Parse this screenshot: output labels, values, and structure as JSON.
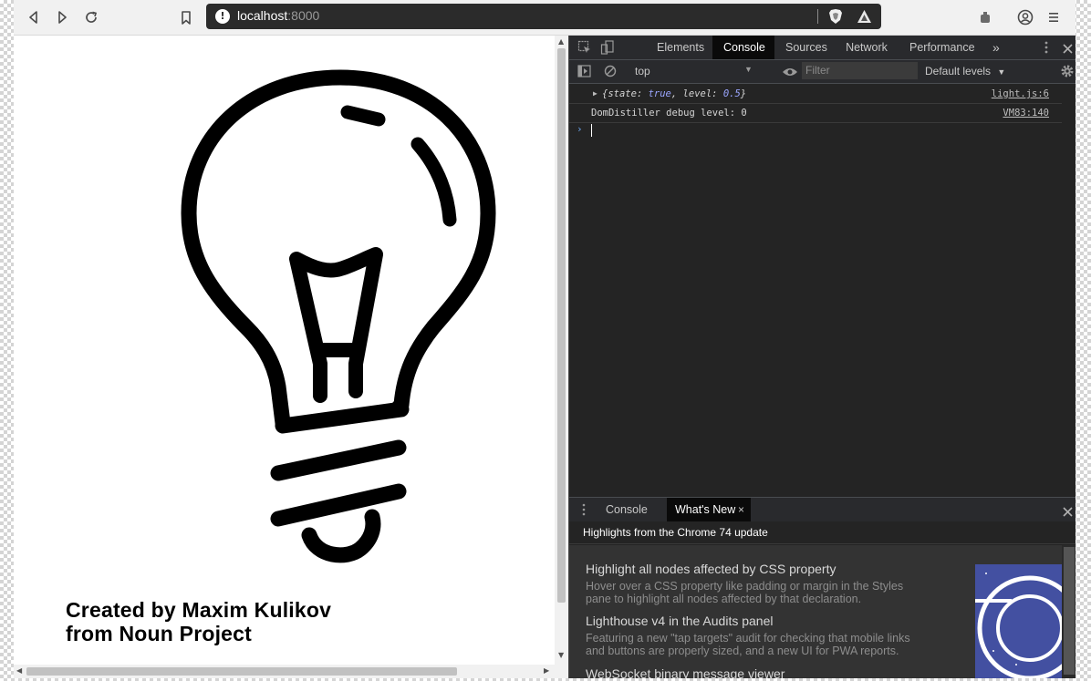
{
  "browser": {
    "url_host": "localhost",
    "url_port": ":8000"
  },
  "page": {
    "credit_line1": "Created by Maxim Kulikov",
    "credit_line2": "from Noun Project"
  },
  "devtools": {
    "tabs": [
      "Elements",
      "Console",
      "Sources",
      "Network",
      "Performance",
      "»"
    ],
    "active_tab": "Console",
    "context": "top",
    "filter_placeholder": "Filter",
    "levels_label": "Default levels",
    "messages": [
      {
        "prefix": "{",
        "k1": "state",
        "v1": "true",
        "k2": "level",
        "v2": "0.5",
        "suffix": "}",
        "source": "light.js:6"
      },
      {
        "text": "DomDistiller debug level: 0",
        "source": "VM83:140"
      }
    ],
    "drawer": {
      "tabs": [
        "Console",
        "What's New"
      ],
      "active_tab": "What's New",
      "header": "Highlights from the Chrome 74 update",
      "items": [
        {
          "title": "Highlight all nodes affected by CSS property",
          "desc_line1": "Hover over a CSS property like padding or margin in the Styles",
          "desc_line2": "pane to highlight all nodes affected by that declaration."
        },
        {
          "title": "Lighthouse v4 in the Audits panel",
          "desc_line1": "Featuring a new \"tap targets\" audit for checking that mobile links",
          "desc_line2": "and buttons are properly sized, and a new UI for PWA reports."
        },
        {
          "title": "WebSocket binary message viewer"
        }
      ]
    }
  },
  "colors": {
    "devtools_bg": "#242424",
    "whatsnew_thumb": "#4350a1",
    "link_value": "#9ba6ff"
  },
  "icons": {
    "toolbar": [
      "back-icon",
      "forward-icon",
      "reload-icon",
      "bookmark-icon",
      "info-icon",
      "brave-shield-icon",
      "brave-rewards-icon",
      "extension-icon",
      "profile-icon",
      "menu-icon"
    ],
    "devtools": [
      "inspect-element-icon",
      "device-toggle-icon",
      "more-vert-icon",
      "close-icon",
      "sidebar-toggle-icon",
      "clear-console-icon",
      "eye-icon",
      "settings-gear-icon"
    ]
  }
}
